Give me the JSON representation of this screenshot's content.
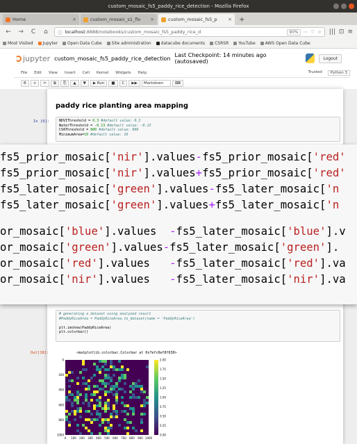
{
  "window": {
    "title": "custom_mosaic_fs5_paddy_rice_detection - Mozilla Firefox"
  },
  "tabs": [
    {
      "label": "Home",
      "active": false
    },
    {
      "label": "custom_mosaic_s1_flo",
      "active": false
    },
    {
      "label": "custom_mosaic_fs5_p",
      "active": true
    }
  ],
  "newtab_label": "+",
  "navbar": {
    "back": "←",
    "forward": "→",
    "reload": "C",
    "home": "⌂",
    "url_host": "localhost",
    "url_path": ":8888/notebooks/custom_mosaic_fs5_paddy_rice_d",
    "zoom": "90%",
    "right_icons": [
      "⋯",
      "♡",
      "☆",
      "|||",
      "⊡",
      "≡"
    ]
  },
  "bookmarks": [
    "Most Visited",
    "Jupyter",
    "Open Data Cube",
    "Site administration",
    "datacube documents",
    "CSRSR",
    "YouTube",
    "AWS Open Data Cube"
  ],
  "jupyter": {
    "logo_text": "jupyter",
    "notebook_name": "custom_mosaic_fs5_paddy_rice_detection",
    "checkpoint": "Last Checkpoint: 14 minutes ago  (autosaved)",
    "logout": "Logout",
    "menu": [
      "File",
      "Edit",
      "View",
      "Insert",
      "Cell",
      "Kernel",
      "Widgets",
      "Help"
    ],
    "trusted": "Trusted",
    "kernel": "Python 3",
    "toolbar": [
      "B",
      "+",
      "✂",
      "⧉",
      "⎘",
      "▲",
      "▼",
      "▶ Run",
      "■",
      "C",
      "▶▶"
    ],
    "cell_type": "Markdown"
  },
  "notebook": {
    "heading": "paddy rice planting area mapping",
    "cell1_prompt": "In [6]:",
    "cell1_lines": [
      {
        "code": "NDVIThreshold = ",
        "num": "0.3",
        "comment": " #default value: 0.3"
      },
      {
        "code": "WaterThreshold = ",
        "num": "-0.13",
        "comment": " #default value: -0.13"
      },
      {
        "code": "CVAThreshold = ",
        "num": "800",
        "comment": " #default value: 800"
      },
      {
        "code": "MinimumArea=",
        "num": "10",
        "comment": " #default value: 10"
      }
    ],
    "overlay_lines_a": [
      [
        "fs5_prior_mosaic[",
        "'nir'",
        "].values",
        "-",
        "fs5_prior_mosaic[",
        "'red'"
      ],
      [
        "fs5_prior_mosaic[",
        "'nir'",
        "].values",
        "+",
        "fs5_prior_mosaic[",
        "'red'"
      ],
      [
        "fs5_later_mosaic[",
        "'green'",
        "].values",
        "-",
        "fs5_later_mosaic[",
        "'n"
      ],
      [
        "fs5_later_mosaic[",
        "'green'",
        "].values",
        "+",
        "fs5_later_mosaic[",
        "'n"
      ]
    ],
    "overlay_lines_b": [
      [
        "or_mosaic[",
        "'blue'",
        "].values  ",
        "-",
        "fs5_later_mosaic[",
        "'blue'",
        "].v"
      ],
      [
        "or_mosaic[",
        "'green'",
        "].values",
        "-",
        "fs5_later_mosaic[",
        "'green'",
        "]."
      ],
      [
        "or_mosaic[",
        "'red'",
        "].values   ",
        "-",
        "fs5_later_mosaic[",
        "'red'",
        "].va"
      ],
      [
        "or_mosaic[",
        "'nir'",
        "].values   ",
        "-",
        "fs5_later_mosaic[",
        "'nir'",
        "].va"
      ]
    ],
    "cell2_lines": [
      {
        "text": "# generating a dataset using analyzed result",
        "comment": true
      },
      {
        "text": "#PaddyRiceArea = PaddyRiceArea.to_dataset(name = 'PaddyRiceArea')",
        "comment": true
      },
      {
        "text": "",
        "comment": false
      },
      {
        "text": "plt.imshow(PaddyRiceArea)",
        "comment": false
      },
      {
        "text": "plt.colorbar()",
        "comment": false
      }
    ],
    "out_prompt": "Out[18]:",
    "out_text": "<matplotlib.colorbar.Colorbar at 0x7efc0ef8f630>"
  },
  "chart_data": {
    "type": "heatmap",
    "title": "",
    "xlabel": "",
    "ylabel": "",
    "x_ticks": [
      0,
      100,
      200,
      300,
      400,
      500,
      600,
      700,
      800,
      900,
      1000
    ],
    "y_ticks": [
      0,
      200,
      400,
      600,
      800,
      1000
    ],
    "colorbar_ticks": [
      0.0,
      0.25,
      0.5,
      0.75,
      1.0,
      1.25,
      1.5,
      1.75,
      2.0
    ],
    "colormap": "viridis",
    "xlim": [
      0,
      1000
    ],
    "ylim": [
      1000,
      0
    ]
  }
}
